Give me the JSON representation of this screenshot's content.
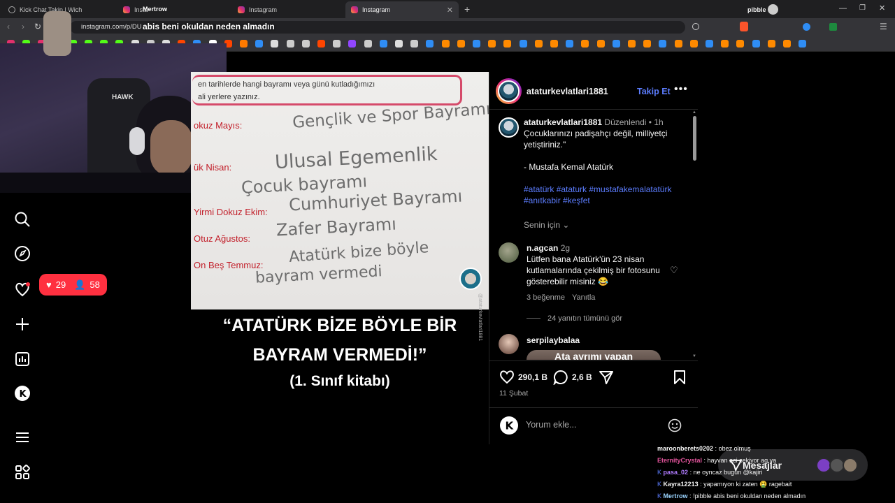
{
  "browser": {
    "tabs": [
      {
        "label": "Kick Chat Takip | Wich",
        "active": false
      },
      {
        "label": "Insta",
        "active": false
      },
      {
        "label": "Instagram",
        "active": false
      },
      {
        "label": "Instagram",
        "active": true
      }
    ],
    "tab_overlay_name": "Mertrow",
    "url": "instagram.com/p/DU",
    "profile_name": "pibble"
  },
  "stream": {
    "title_overlay": "abis beni okuldan neden almadın"
  },
  "post": {
    "image": {
      "header_line1": "en tarihlerde hangi bayramı veya günü kutladığımızı",
      "header_line2": "ali yerlere yazınız.",
      "rows": [
        {
          "label": "okuz Mayıs:",
          "answer": "Gençlik ve Spor Bayramı"
        },
        {
          "label": "ük Nisan:",
          "answer": "Ulusal Egemenlik"
        },
        {
          "label": "",
          "answer": "Çocuk bayramı"
        },
        {
          "label": "Yirmi Dokuz Ekim:",
          "answer": "Cumhuriyet Bayramı"
        },
        {
          "label": "Otuz Ağustos:",
          "answer": "Zafer Bayramı"
        },
        {
          "label": "On Beş Temmuz:",
          "answer": "Atatürk bize böyle"
        },
        {
          "label": "",
          "answer": "bayram vermedi"
        }
      ],
      "caption_line1": "“ATATÜRK BİZE BÖYLE BİR",
      "caption_line2": "BAYRAM VERMEDİ!”",
      "caption_line3": "(1. Sınıf kitabı)",
      "side_handle": "@ataturkevlatlari1881"
    },
    "author": "ataturkevlatlari1881",
    "follow_label": "Takip Et",
    "caption_author": "ataturkevlatlari1881",
    "edited_label": "Düzenlendi",
    "caption_time": "1h",
    "caption_lines": [
      "Çocuklarınızı padişahçı değil, milliyetçi",
      "yetiştiriniz.\""
    ],
    "caption_quote": "- Mustafa Kemal Atatürk",
    "hashtags_line1": "#atatürk #ataturk #mustafakemalatatürk",
    "hashtags_line2": "#anıtkabir #keşfet",
    "for_you_label": "Senin için",
    "comments": [
      {
        "user": "n.agcan",
        "time": "2g",
        "lines": [
          "Lütfen bana Atatürk'ün 23 nisan",
          "kutlamalarında çekilmiş bir fotosunu",
          "gösterebilir misiniz 😂"
        ],
        "likes": "3 beğenme",
        "reply_label": "Yanıtla",
        "view_replies": "24 yanıtın tümünü gör"
      },
      {
        "user": "serpilaybalaa",
        "preview_text": "Ata ayrımı yapan"
      }
    ],
    "like_count": "290,1 B",
    "comment_count": "2,6 B",
    "date": "11 Şubat",
    "comment_placeholder": "Yorum ekle..."
  },
  "notification": {
    "likes": "29",
    "follows": "58"
  },
  "messages_label": "Mesajlar",
  "chat": [
    {
      "user": "maroonberets0202",
      "text": "obez olmuş",
      "color": "#c7c7c7"
    },
    {
      "user": "EternityCrystal",
      "text": "hayvan aci cekiyor ag ya",
      "color": "#e0539a"
    },
    {
      "user": "pasa_02",
      "text": "ne oyncaz bugün @kajiri",
      "color": "#b07bff"
    },
    {
      "user": "Kayra12213",
      "text": "yapamıyon ki zaten 🤮 ragebait",
      "color": "#d0d0d0"
    },
    {
      "user": "Mertrow",
      "text": "!pibble abis beni okuldan neden almadın",
      "color": "#9ad4ff"
    }
  ],
  "colors": {
    "accent": "#5c7dff",
    "follow": "#0095f6",
    "notif": "#ff3040"
  }
}
